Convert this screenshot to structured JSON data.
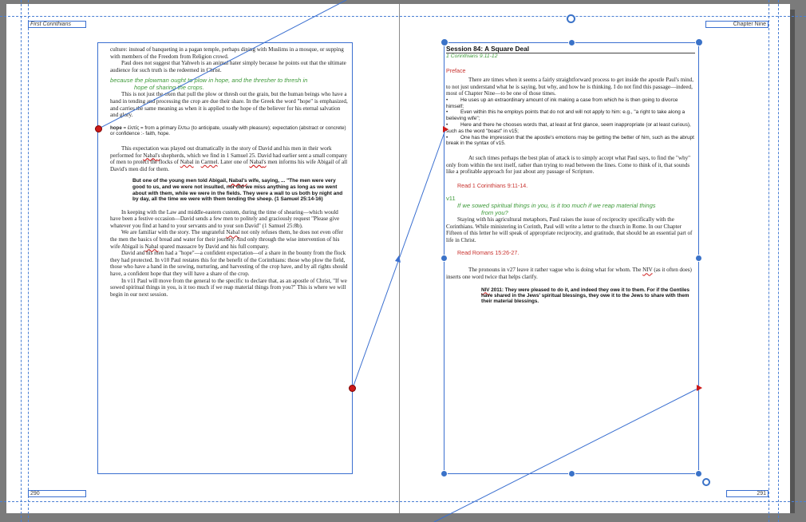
{
  "spread": {
    "left_page": {
      "running_head": "First Corinthians",
      "folio": "290",
      "blocks": [
        {
          "type": "p",
          "text": "culture: instead of banqueting in a pagan temple, perhaps dining with Muslims in a mosque, or supping with members of the Freedom from Religion crowd."
        },
        {
          "type": "p",
          "text": "Paul does not suggest that Yahweh is an animal hater simply because he points out that the ultimate audience for such truth is the redeemed in Christ.",
          "indent": true
        },
        {
          "type": "green",
          "line1": "because the plowman ought to plow in hope, and the thresher to thresh in",
          "line2": "hope of sharing the crops."
        },
        {
          "type": "p",
          "text": "This is not just the oxen that pull the plow or thresh out the grain, but the human beings who have a hand in tending and processing the crop are due their share. In the Greek the word \"hope\" is emphasized, and carries the same meaning as when it is applied to the hope of the believer for his eternal salvation and glory.",
          "indent": true
        },
        {
          "type": "def",
          "term": "hope",
          "text": " = ἐλπίς = from a primary ἔλπω (to anticipate, usually with pleasure); expectation (abstract or concrete) or confidence :- faith, hope."
        },
        {
          "type": "p",
          "text": "This expectation was played out dramatically in the story of David and his men in their work performed for Nabal's shepherds, which we find in 1 Samuel 25. David had earlier sent a small company of men to protect the flocks of Nabal in Carmel. Later one of Nabal's men informs his wife Abigail of all David's men did for them.",
          "indent": true
        },
        {
          "type": "quote",
          "text": "But one of the young men told Abigail, Nabal's wife, saying, ... \"The men were very good to us, and we were not insulted, nor did we miss anything as long as we went about with them, while we were in the fields. They were a wall to us both by night and by day, all the time we were with them tending the sheep. (1 Samuel 25:14-16)"
        },
        {
          "type": "p",
          "text": "In keeping with the Law and middle-eastern custom, during the time of shearing—which would have been a festive occasion—David sends a few men to politely and graciously request \"Please give whatever you find at hand to your servants and to your son David\" (1 Samuel 25:8b).",
          "indent": true
        },
        {
          "type": "p",
          "text": "We are familiar with the story. The ungrateful Nabal not only refuses them, he does not even offer the men the basics of bread and water for their journey. And only through the wise intervention of his wife Abigail is Nabal spared massacre by David and his full company.",
          "indent": true
        },
        {
          "type": "p",
          "text": "David and his men had a \"hope\"—a confident expectation—of a share in the bounty from the flock they had protected. In v10 Paul restates this for the benefit of the Corinthians: those who plow the field, those who have a hand in the sowing, nurturing, and harvesting of the crop have, and by all rights should have, a confident hope that they will have a share of the crop.",
          "indent": true
        },
        {
          "type": "p",
          "text": "In v11 Paul will move from the general to the specific to declare that, as an apostle of Christ, \"If we sowed spiritual things in you, is it too much if we reap material things from you?\" This is where we will begin in our next session.",
          "indent": true
        }
      ]
    },
    "right_page": {
      "running_head": "Chapter Nine",
      "folio": "291",
      "session_title": "Session 84: A Square Deal",
      "session_ref": "1 Corinthians 9:11-12",
      "preface_label": "Preface",
      "preface_intro": "There are times when it seems a fairly straightforward process to get inside the apostle Paul's mind, to not just understand what he is saying, but why, and how he is thinking. I do not find this passage—indeed, most of Chapter Nine—to be one of those times.",
      "bullets": [
        "He uses up an extraordinary amount of ink making a case from which he is then going to divorce himself;",
        "Even within this he employs points that do not and will not apply to him: e.g., \"a right to take along a believing wife\";",
        "Here and there he chooses words that, at least at first glance, seem inappropriate (or at least curious), such as the word \"boast\" in v15;",
        "One has the impression that the apostle's emotions may be getting the better of him, such as the abrupt break in the syntax of v15."
      ],
      "para_after": "At such times perhaps the best plan of attack is to simply accept what Paul says, to find the \"why\" only from within the text itself, rather than trying to read between the lines. Come to think of it, that sounds like a profitable approach for just about any passage of Scripture.",
      "read1": "Read 1 Corinthians 9:11-14.",
      "verse_label": "v11",
      "verse_line1": "If we sowed spiritual things in you, is it too much if we reap material things",
      "verse_line2": "from you?",
      "para_v11": "Staying with his agricultural metaphors, Paul raises the issue of reciprocity specifically with the Corinthians. While ministering in Corinth, Paul will write a letter to the church in Rome. In our Chapter Fifteen of this letter he will speak of appropriate reciprocity, and gratitude, that should be an essential part of life in Christ.",
      "read2": "Read Romans 15:26-27.",
      "para_pronouns": "The pronouns in v27 leave it rather vague who is doing what for whom. The NIV (as it often does) inserts one word twice that helps clarify.",
      "niv_quote": "NIV 2011: They were pleased to do it, and indeed they owe it to them. For if the Gentiles have shared in the Jews' spiritual blessings, they owe it to the Jews to share with them their material blessings."
    }
  },
  "colors": {
    "pasteboard": "#7b7b7b",
    "frame_blue": "#3a6fd0",
    "handle_blue": "#3a72c8",
    "port_red": "#cc1a1a",
    "heading_green": "#3e9a3a",
    "label_red": "#c8322e"
  },
  "icons": {
    "frame_handle": "circle-handle",
    "in_port": "triangle-port",
    "out_port": "red-dot-port",
    "rotate_handle": "ring-handle"
  }
}
